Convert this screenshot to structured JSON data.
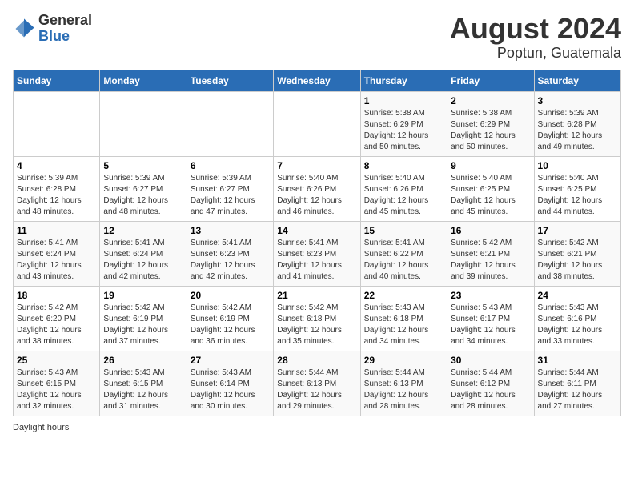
{
  "header": {
    "logo_general": "General",
    "logo_blue": "Blue",
    "title": "August 2024",
    "subtitle": "Poptun, Guatemala"
  },
  "calendar": {
    "days_of_week": [
      "Sunday",
      "Monday",
      "Tuesday",
      "Wednesday",
      "Thursday",
      "Friday",
      "Saturday"
    ],
    "weeks": [
      [
        {
          "day": "",
          "info": ""
        },
        {
          "day": "",
          "info": ""
        },
        {
          "day": "",
          "info": ""
        },
        {
          "day": "",
          "info": ""
        },
        {
          "day": "1",
          "info": "Sunrise: 5:38 AM\nSunset: 6:29 PM\nDaylight: 12 hours\nand 50 minutes."
        },
        {
          "day": "2",
          "info": "Sunrise: 5:38 AM\nSunset: 6:29 PM\nDaylight: 12 hours\nand 50 minutes."
        },
        {
          "day": "3",
          "info": "Sunrise: 5:39 AM\nSunset: 6:28 PM\nDaylight: 12 hours\nand 49 minutes."
        }
      ],
      [
        {
          "day": "4",
          "info": "Sunrise: 5:39 AM\nSunset: 6:28 PM\nDaylight: 12 hours\nand 48 minutes."
        },
        {
          "day": "5",
          "info": "Sunrise: 5:39 AM\nSunset: 6:27 PM\nDaylight: 12 hours\nand 48 minutes."
        },
        {
          "day": "6",
          "info": "Sunrise: 5:39 AM\nSunset: 6:27 PM\nDaylight: 12 hours\nand 47 minutes."
        },
        {
          "day": "7",
          "info": "Sunrise: 5:40 AM\nSunset: 6:26 PM\nDaylight: 12 hours\nand 46 minutes."
        },
        {
          "day": "8",
          "info": "Sunrise: 5:40 AM\nSunset: 6:26 PM\nDaylight: 12 hours\nand 45 minutes."
        },
        {
          "day": "9",
          "info": "Sunrise: 5:40 AM\nSunset: 6:25 PM\nDaylight: 12 hours\nand 45 minutes."
        },
        {
          "day": "10",
          "info": "Sunrise: 5:40 AM\nSunset: 6:25 PM\nDaylight: 12 hours\nand 44 minutes."
        }
      ],
      [
        {
          "day": "11",
          "info": "Sunrise: 5:41 AM\nSunset: 6:24 PM\nDaylight: 12 hours\nand 43 minutes."
        },
        {
          "day": "12",
          "info": "Sunrise: 5:41 AM\nSunset: 6:24 PM\nDaylight: 12 hours\nand 42 minutes."
        },
        {
          "day": "13",
          "info": "Sunrise: 5:41 AM\nSunset: 6:23 PM\nDaylight: 12 hours\nand 42 minutes."
        },
        {
          "day": "14",
          "info": "Sunrise: 5:41 AM\nSunset: 6:23 PM\nDaylight: 12 hours\nand 41 minutes."
        },
        {
          "day": "15",
          "info": "Sunrise: 5:41 AM\nSunset: 6:22 PM\nDaylight: 12 hours\nand 40 minutes."
        },
        {
          "day": "16",
          "info": "Sunrise: 5:42 AM\nSunset: 6:21 PM\nDaylight: 12 hours\nand 39 minutes."
        },
        {
          "day": "17",
          "info": "Sunrise: 5:42 AM\nSunset: 6:21 PM\nDaylight: 12 hours\nand 38 minutes."
        }
      ],
      [
        {
          "day": "18",
          "info": "Sunrise: 5:42 AM\nSunset: 6:20 PM\nDaylight: 12 hours\nand 38 minutes."
        },
        {
          "day": "19",
          "info": "Sunrise: 5:42 AM\nSunset: 6:19 PM\nDaylight: 12 hours\nand 37 minutes."
        },
        {
          "day": "20",
          "info": "Sunrise: 5:42 AM\nSunset: 6:19 PM\nDaylight: 12 hours\nand 36 minutes."
        },
        {
          "day": "21",
          "info": "Sunrise: 5:42 AM\nSunset: 6:18 PM\nDaylight: 12 hours\nand 35 minutes."
        },
        {
          "day": "22",
          "info": "Sunrise: 5:43 AM\nSunset: 6:18 PM\nDaylight: 12 hours\nand 34 minutes."
        },
        {
          "day": "23",
          "info": "Sunrise: 5:43 AM\nSunset: 6:17 PM\nDaylight: 12 hours\nand 34 minutes."
        },
        {
          "day": "24",
          "info": "Sunrise: 5:43 AM\nSunset: 6:16 PM\nDaylight: 12 hours\nand 33 minutes."
        }
      ],
      [
        {
          "day": "25",
          "info": "Sunrise: 5:43 AM\nSunset: 6:15 PM\nDaylight: 12 hours\nand 32 minutes."
        },
        {
          "day": "26",
          "info": "Sunrise: 5:43 AM\nSunset: 6:15 PM\nDaylight: 12 hours\nand 31 minutes."
        },
        {
          "day": "27",
          "info": "Sunrise: 5:43 AM\nSunset: 6:14 PM\nDaylight: 12 hours\nand 30 minutes."
        },
        {
          "day": "28",
          "info": "Sunrise: 5:44 AM\nSunset: 6:13 PM\nDaylight: 12 hours\nand 29 minutes."
        },
        {
          "day": "29",
          "info": "Sunrise: 5:44 AM\nSunset: 6:13 PM\nDaylight: 12 hours\nand 28 minutes."
        },
        {
          "day": "30",
          "info": "Sunrise: 5:44 AM\nSunset: 6:12 PM\nDaylight: 12 hours\nand 28 minutes."
        },
        {
          "day": "31",
          "info": "Sunrise: 5:44 AM\nSunset: 6:11 PM\nDaylight: 12 hours\nand 27 minutes."
        }
      ]
    ]
  },
  "footer": {
    "note": "Daylight hours"
  }
}
